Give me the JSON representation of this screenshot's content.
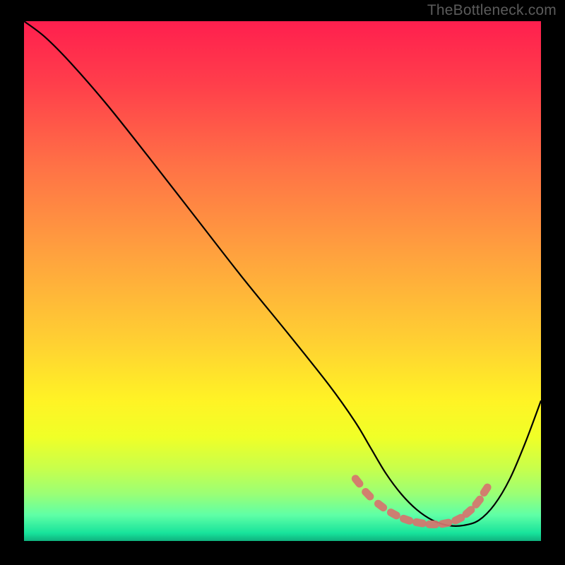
{
  "watermark": "TheBottleneck.com",
  "chart_data": {
    "type": "line",
    "title": "",
    "xlabel": "",
    "ylabel": "",
    "xlim": [
      0,
      100
    ],
    "ylim": [
      0,
      100
    ],
    "background_gradient": {
      "stops": [
        {
          "offset": 0.0,
          "color": "#ff1f4e"
        },
        {
          "offset": 0.12,
          "color": "#ff3e4b"
        },
        {
          "offset": 0.28,
          "color": "#ff7246"
        },
        {
          "offset": 0.45,
          "color": "#ffa23e"
        },
        {
          "offset": 0.62,
          "color": "#ffd132"
        },
        {
          "offset": 0.73,
          "color": "#fff325"
        },
        {
          "offset": 0.8,
          "color": "#f0ff27"
        },
        {
          "offset": 0.86,
          "color": "#c8ff4b"
        },
        {
          "offset": 0.91,
          "color": "#9aff76"
        },
        {
          "offset": 0.95,
          "color": "#5fffa6"
        },
        {
          "offset": 0.985,
          "color": "#17e39b"
        },
        {
          "offset": 1.0,
          "color": "#0fb17e"
        }
      ]
    },
    "series": [
      {
        "name": "bottleneck-curve",
        "color": "#000000",
        "x": [
          0,
          4,
          9,
          16,
          24,
          33,
          42,
          51,
          59,
          64,
          67,
          70,
          73,
          76,
          79,
          82,
          85,
          88,
          91,
          94,
          97,
          100
        ],
        "y": [
          100,
          97,
          92,
          84,
          74,
          62.5,
          51,
          40,
          30,
          23,
          18,
          13,
          9,
          6,
          4,
          3,
          3,
          4,
          7,
          12,
          19,
          27
        ]
      }
    ],
    "markers": {
      "name": "highlighted-range",
      "color": "#d6746e",
      "points": [
        {
          "x": 64.5,
          "y": 11.5
        },
        {
          "x": 66.5,
          "y": 9.0
        },
        {
          "x": 69.0,
          "y": 6.8
        },
        {
          "x": 71.5,
          "y": 5.2
        },
        {
          "x": 74.0,
          "y": 4.1
        },
        {
          "x": 76.5,
          "y": 3.5
        },
        {
          "x": 79.0,
          "y": 3.2
        },
        {
          "x": 81.5,
          "y": 3.4
        },
        {
          "x": 84.0,
          "y": 4.2
        },
        {
          "x": 86.0,
          "y": 5.6
        },
        {
          "x": 87.8,
          "y": 7.5
        },
        {
          "x": 89.3,
          "y": 9.8
        }
      ]
    }
  }
}
